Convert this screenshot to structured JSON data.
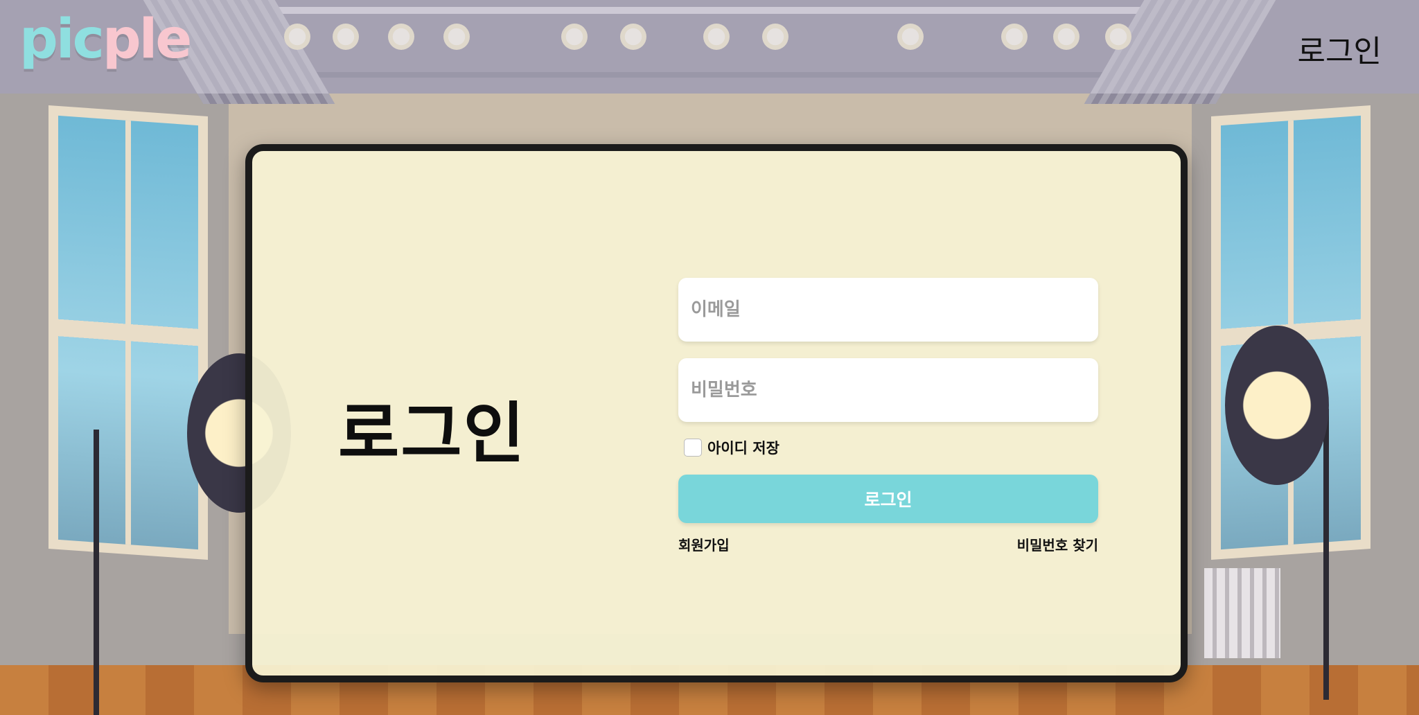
{
  "header": {
    "logo_part1": "pic",
    "logo_part2": "ple",
    "login_link": "로그인"
  },
  "card": {
    "title": "로그인",
    "email_placeholder": "이메일",
    "password_placeholder": "비밀번호",
    "remember_label": "아이디 저장",
    "remember_checked": false,
    "login_button": "로그인",
    "signup_link": "회원가입",
    "find_password_link": "비밀번호 찾기"
  },
  "colors": {
    "logo_teal": "#8fdfe0",
    "logo_pink": "#f8c7cf",
    "button_teal": "#79d6da",
    "card_background": "#f8f3d4",
    "card_border": "#1b1b1b"
  }
}
